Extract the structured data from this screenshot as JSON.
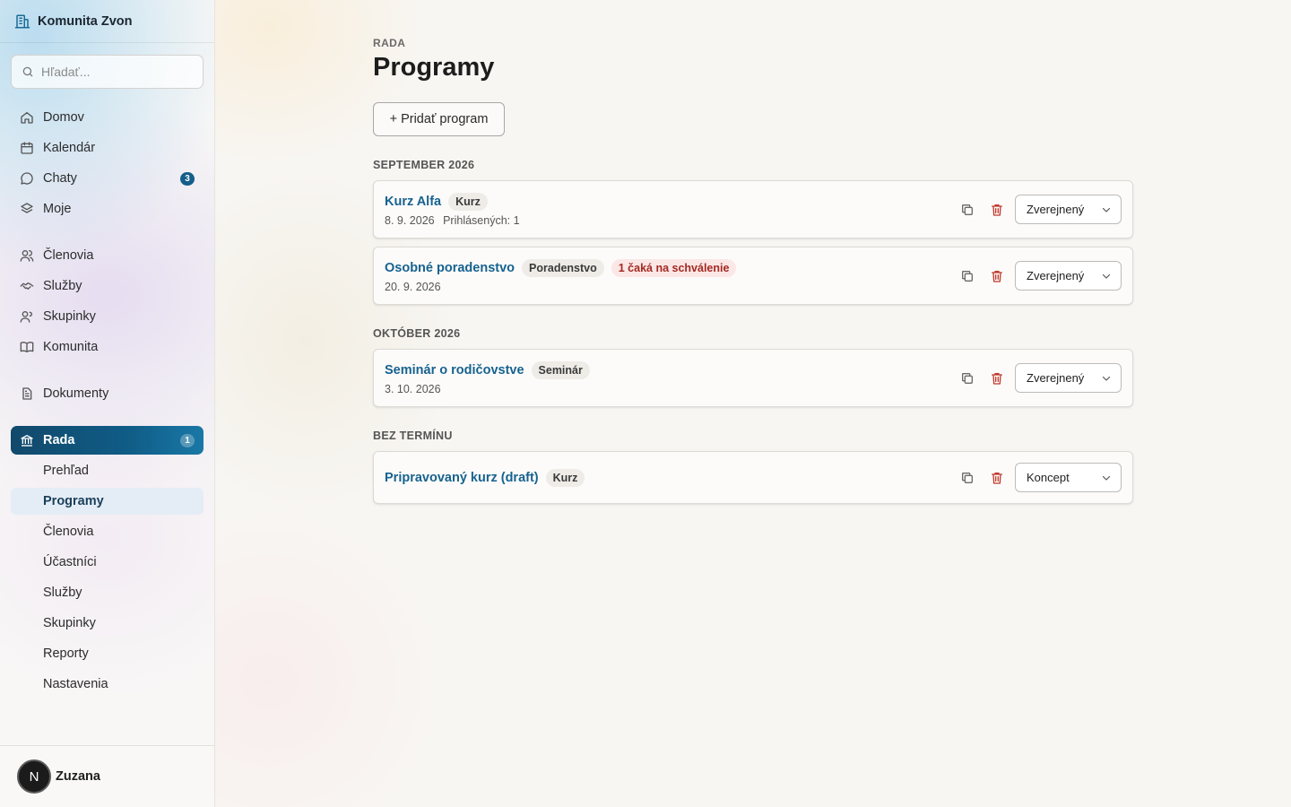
{
  "app": {
    "name": "Komunita Zvon"
  },
  "search": {
    "placeholder": "Hľadať..."
  },
  "nav": {
    "home": "Domov",
    "calendar": "Kalendár",
    "chats": "Chaty",
    "chats_badge": "3",
    "mine": "Moje",
    "members": "Členovia",
    "services": "Služby",
    "groups": "Skupinky",
    "community": "Komunita",
    "documents": "Dokumenty",
    "council": "Rada",
    "council_badge": "1"
  },
  "council_sub": {
    "overview": "Prehľad",
    "programs": "Programy",
    "members": "Členovia",
    "participants": "Účastníci",
    "services": "Služby",
    "groups": "Skupinky",
    "reports": "Reporty",
    "settings": "Nastavenia"
  },
  "user": {
    "initial": "N",
    "name": "Zuzana"
  },
  "page": {
    "eyebrow": "RADA",
    "title": "Programy",
    "add_button": "+ Pridať program"
  },
  "sections": [
    {
      "label": "SEPTEMBER 2026",
      "programs": [
        {
          "title": "Kurz Alfa",
          "tag": "Kurz",
          "date": "8. 9. 2026",
          "extra": "Prihlásených: 1",
          "status": "Zverejnený"
        },
        {
          "title": "Osobné poradenstvo",
          "tag": "Poradenstvo",
          "warning": "1 čaká na schválenie",
          "date": "20. 9. 2026",
          "status": "Zverejnený"
        }
      ]
    },
    {
      "label": "OKTÓBER 2026",
      "programs": [
        {
          "title": "Seminár o rodičovstve",
          "tag": "Seminár",
          "date": "3. 10. 2026",
          "status": "Zverejnený"
        }
      ]
    },
    {
      "label": "BEZ TERMÍNU",
      "programs": [
        {
          "title": "Pripravovaný kurz (draft)",
          "tag": "Kurz",
          "status": "Koncept"
        }
      ]
    }
  ],
  "colors": {
    "accent": "#17628f",
    "active_nav": "#0f5c86",
    "danger": "#c0392b",
    "warning_bg": "#fbe7e6"
  }
}
